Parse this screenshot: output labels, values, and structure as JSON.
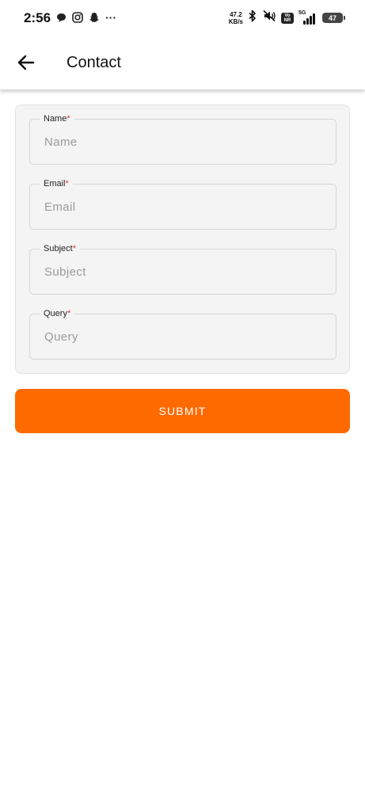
{
  "status_bar": {
    "time": "2:56",
    "more": "···",
    "net_speed_value": "47.2",
    "net_speed_unit": "KB/s",
    "vonr_top": "Vo",
    "vonr_bottom": "NR",
    "network": "5G",
    "battery": "47",
    "icons": [
      "chat-bubble-icon",
      "instagram-icon",
      "snapchat-icon",
      "bluetooth-icon",
      "mute-icon",
      "signal-icon",
      "battery-icon"
    ]
  },
  "app_bar": {
    "title": "Contact",
    "back_icon": "arrow-left-icon"
  },
  "form": {
    "fields": [
      {
        "label": "Name",
        "required_mark": "*",
        "placeholder": "Name",
        "value": ""
      },
      {
        "label": "Email",
        "required_mark": "*",
        "placeholder": "Email",
        "value": ""
      },
      {
        "label": "Subject",
        "required_mark": "*",
        "placeholder": "Subject",
        "value": ""
      },
      {
        "label": "Query",
        "required_mark": "*",
        "placeholder": "Query",
        "value": ""
      }
    ]
  },
  "submit": {
    "label": "SUBMIT"
  },
  "colors": {
    "accent": "#ff6a00",
    "required": "#e53935",
    "card_background": "#f4f4f4"
  }
}
